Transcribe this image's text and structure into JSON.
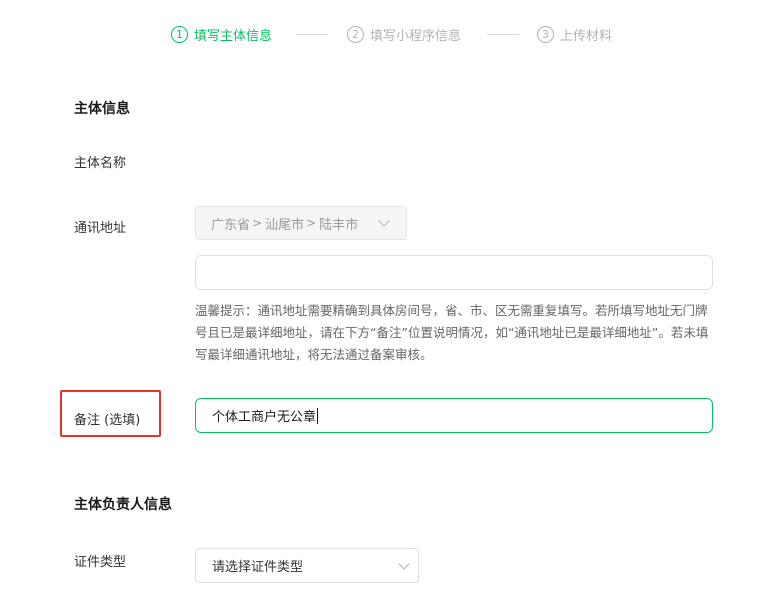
{
  "steps": [
    {
      "num": "1",
      "label": "填写主体信息",
      "active": true
    },
    {
      "num": "2",
      "label": "填写小程序信息",
      "active": false
    },
    {
      "num": "3",
      "label": "上传材料",
      "active": false
    }
  ],
  "sections": {
    "subject_info": "主体信息",
    "responsible_info": "主体负责人信息"
  },
  "fields": {
    "subject_name": {
      "label": "主体名称"
    },
    "address": {
      "label": "通讯地址",
      "province": "广东省",
      "city": "汕尾市",
      "district": "陆丰市",
      "separator": ">",
      "detail_value": "",
      "hint": "温馨提示：通讯地址需要精确到具体房间号，省、市、区无需重复填写。若所填写地址无门牌号且已是最详细地址，请在下方“备注”位置说明情况，如“通讯地址已是最详细地址”。若未填写最详细通讯地址，将无法通过备案审核。"
    },
    "remark": {
      "label": "备注 (选填)",
      "value": "个体工商户无公章"
    },
    "cert_type": {
      "label": "证件类型",
      "placeholder": "请选择证件类型"
    }
  },
  "colors": {
    "accent": "#07c160",
    "highlight": "#e8322e",
    "muted": "#b3b3b3"
  }
}
